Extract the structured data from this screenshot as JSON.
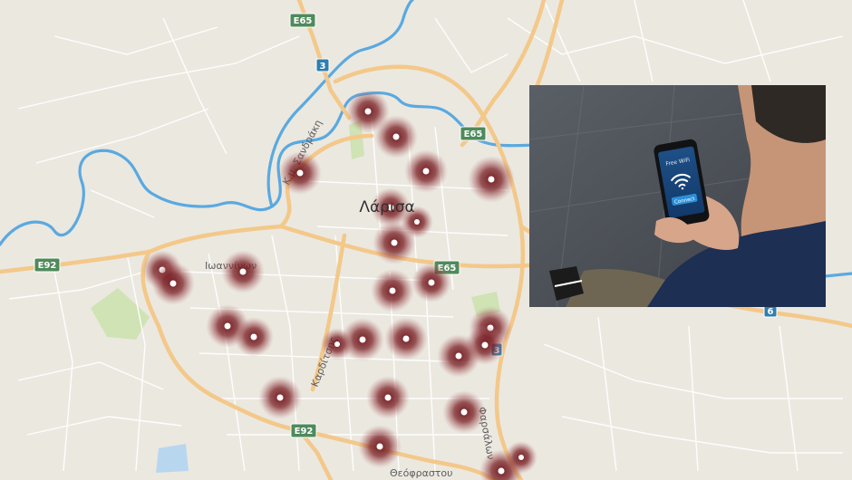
{
  "map": {
    "city_label": "Λάρισα",
    "street_labels": {
      "sandraki": "Κ.μ. Σανδράκη",
      "ioanninon": "Ιωαννίνων",
      "karditsis": "Καρδίτσης",
      "farsalon": "Φαρσάλων",
      "theofrastou": "Θεόφραστου"
    },
    "shields": {
      "e65_top": "E65",
      "e65_right": "E65",
      "e65_center": "E65",
      "e92_left": "E92",
      "e92_bottom": "E92",
      "route3_top": "3",
      "route3_mid": "3",
      "route6_right": "6"
    },
    "hotspot_count": 27,
    "colors": {
      "background": "#ebe8e0",
      "major_road": "#f6c98e",
      "minor_road": "#ffffff",
      "river": "#5aa9e0",
      "park": "#cfe3b4",
      "hotspot": "#7a1f24",
      "shield_green": "#4f8a5b",
      "shield_blue": "#2f7fae"
    }
  },
  "photo": {
    "phone_screen_title": "Free WiFi",
    "phone_button": "Connect",
    "icon": "wifi-icon"
  }
}
